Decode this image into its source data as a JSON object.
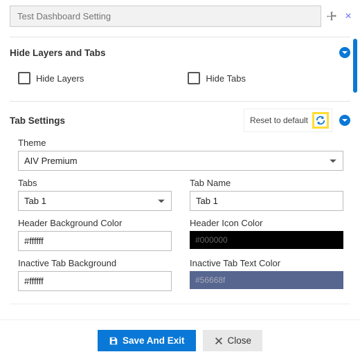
{
  "title_placeholder": "Test Dashboard Setting",
  "sections": {
    "hide": {
      "title": "Hide Layers and Tabs",
      "hide_layers_label": "Hide Layers",
      "hide_tabs_label": "Hide Tabs"
    },
    "tabs": {
      "title": "Tab Settings",
      "reset_label": "Reset to default",
      "fields": {
        "theme_label": "Theme",
        "theme_value": "AIV Premium",
        "tabs_label": "Tabs",
        "tabs_value": "Tab 1",
        "tabname_label": "Tab Name",
        "tabname_value": "Tab 1",
        "hbg_label": "Header Background Color",
        "hbg_value": "#ffffff",
        "hicon_label": "Header Icon Color",
        "hicon_value": "#000000",
        "itbg_label": "Inactive Tab Background",
        "itbg_value": "#ffffff",
        "ittext_label": "Inactive Tab Text Color",
        "ittext_value": "#56668f"
      }
    }
  },
  "footer": {
    "save_label": "Save And Exit",
    "close_label": "Close"
  }
}
